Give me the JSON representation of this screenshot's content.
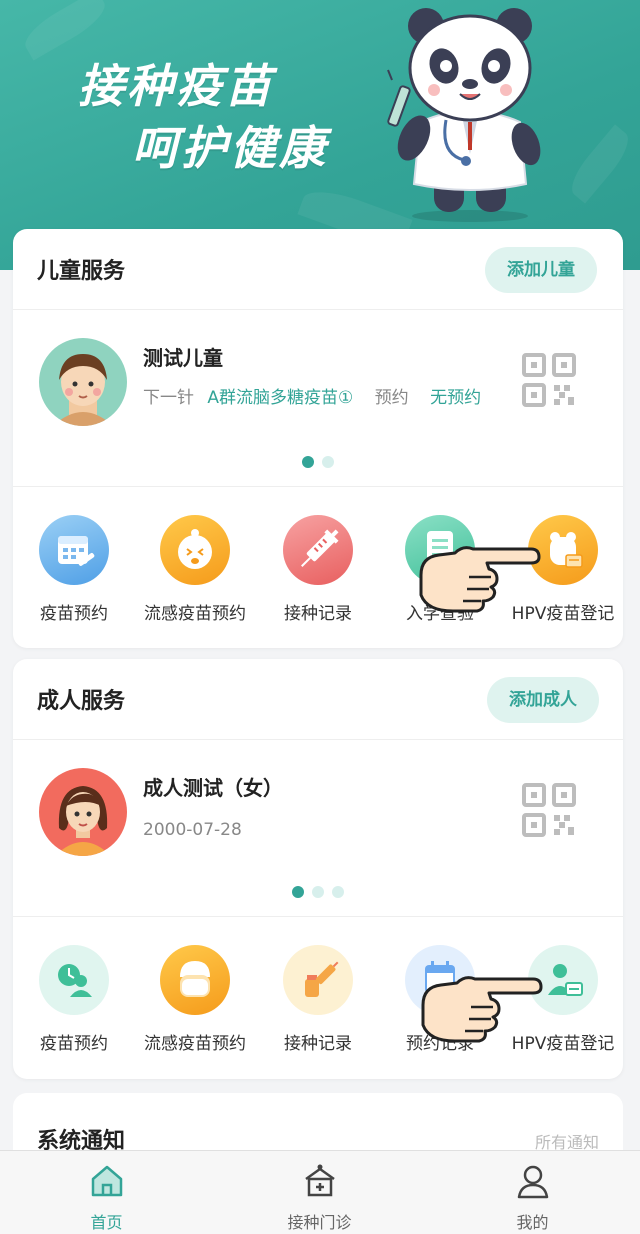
{
  "banner": {
    "line1": "接种疫苗",
    "line2": "呵护健康"
  },
  "child_section": {
    "title": "儿童服务",
    "add_button": "添加儿童",
    "person": {
      "name": "测试儿童",
      "next_dose_label": "下一针",
      "next_dose_value": "A群流脑多糖疫苗①",
      "appointment_label": "预约",
      "appointment_value": "无预约"
    },
    "services": [
      {
        "label": "疫苗预约",
        "icon": "calendar-syringe-icon"
      },
      {
        "label": "流感疫苗预约",
        "icon": "sick-child-icon"
      },
      {
        "label": "接种记录",
        "icon": "syringe-icon"
      },
      {
        "label": "入学查验",
        "icon": "document-icon"
      },
      {
        "label": "HPV疫苗登记",
        "icon": "bear-card-icon"
      }
    ]
  },
  "adult_section": {
    "title": "成人服务",
    "add_button": "添加成人",
    "person": {
      "name": "成人测试（女）",
      "birth_date": "2000-07-28"
    },
    "services": [
      {
        "label": "疫苗预约",
        "icon": "clock-person-icon"
      },
      {
        "label": "流感疫苗预约",
        "icon": "masked-face-icon"
      },
      {
        "label": "接种记录",
        "icon": "vaccine-bottle-icon"
      },
      {
        "label": "预约记录",
        "icon": "calendar-icon"
      },
      {
        "label": "HPV疫苗登记",
        "icon": "person-card-icon"
      }
    ]
  },
  "notice": {
    "title": "系统通知",
    "more_link": "所有通知"
  },
  "tabbar": {
    "tabs": [
      {
        "label": "首页",
        "icon": "home-icon",
        "active": true
      },
      {
        "label": "接种门诊",
        "icon": "clinic-icon",
        "active": false
      },
      {
        "label": "我的",
        "icon": "user-icon",
        "active": false
      }
    ]
  },
  "colors": {
    "accent": "#33a497",
    "accent_light": "#dff3ef",
    "page_bg": "#f3f4f6"
  }
}
